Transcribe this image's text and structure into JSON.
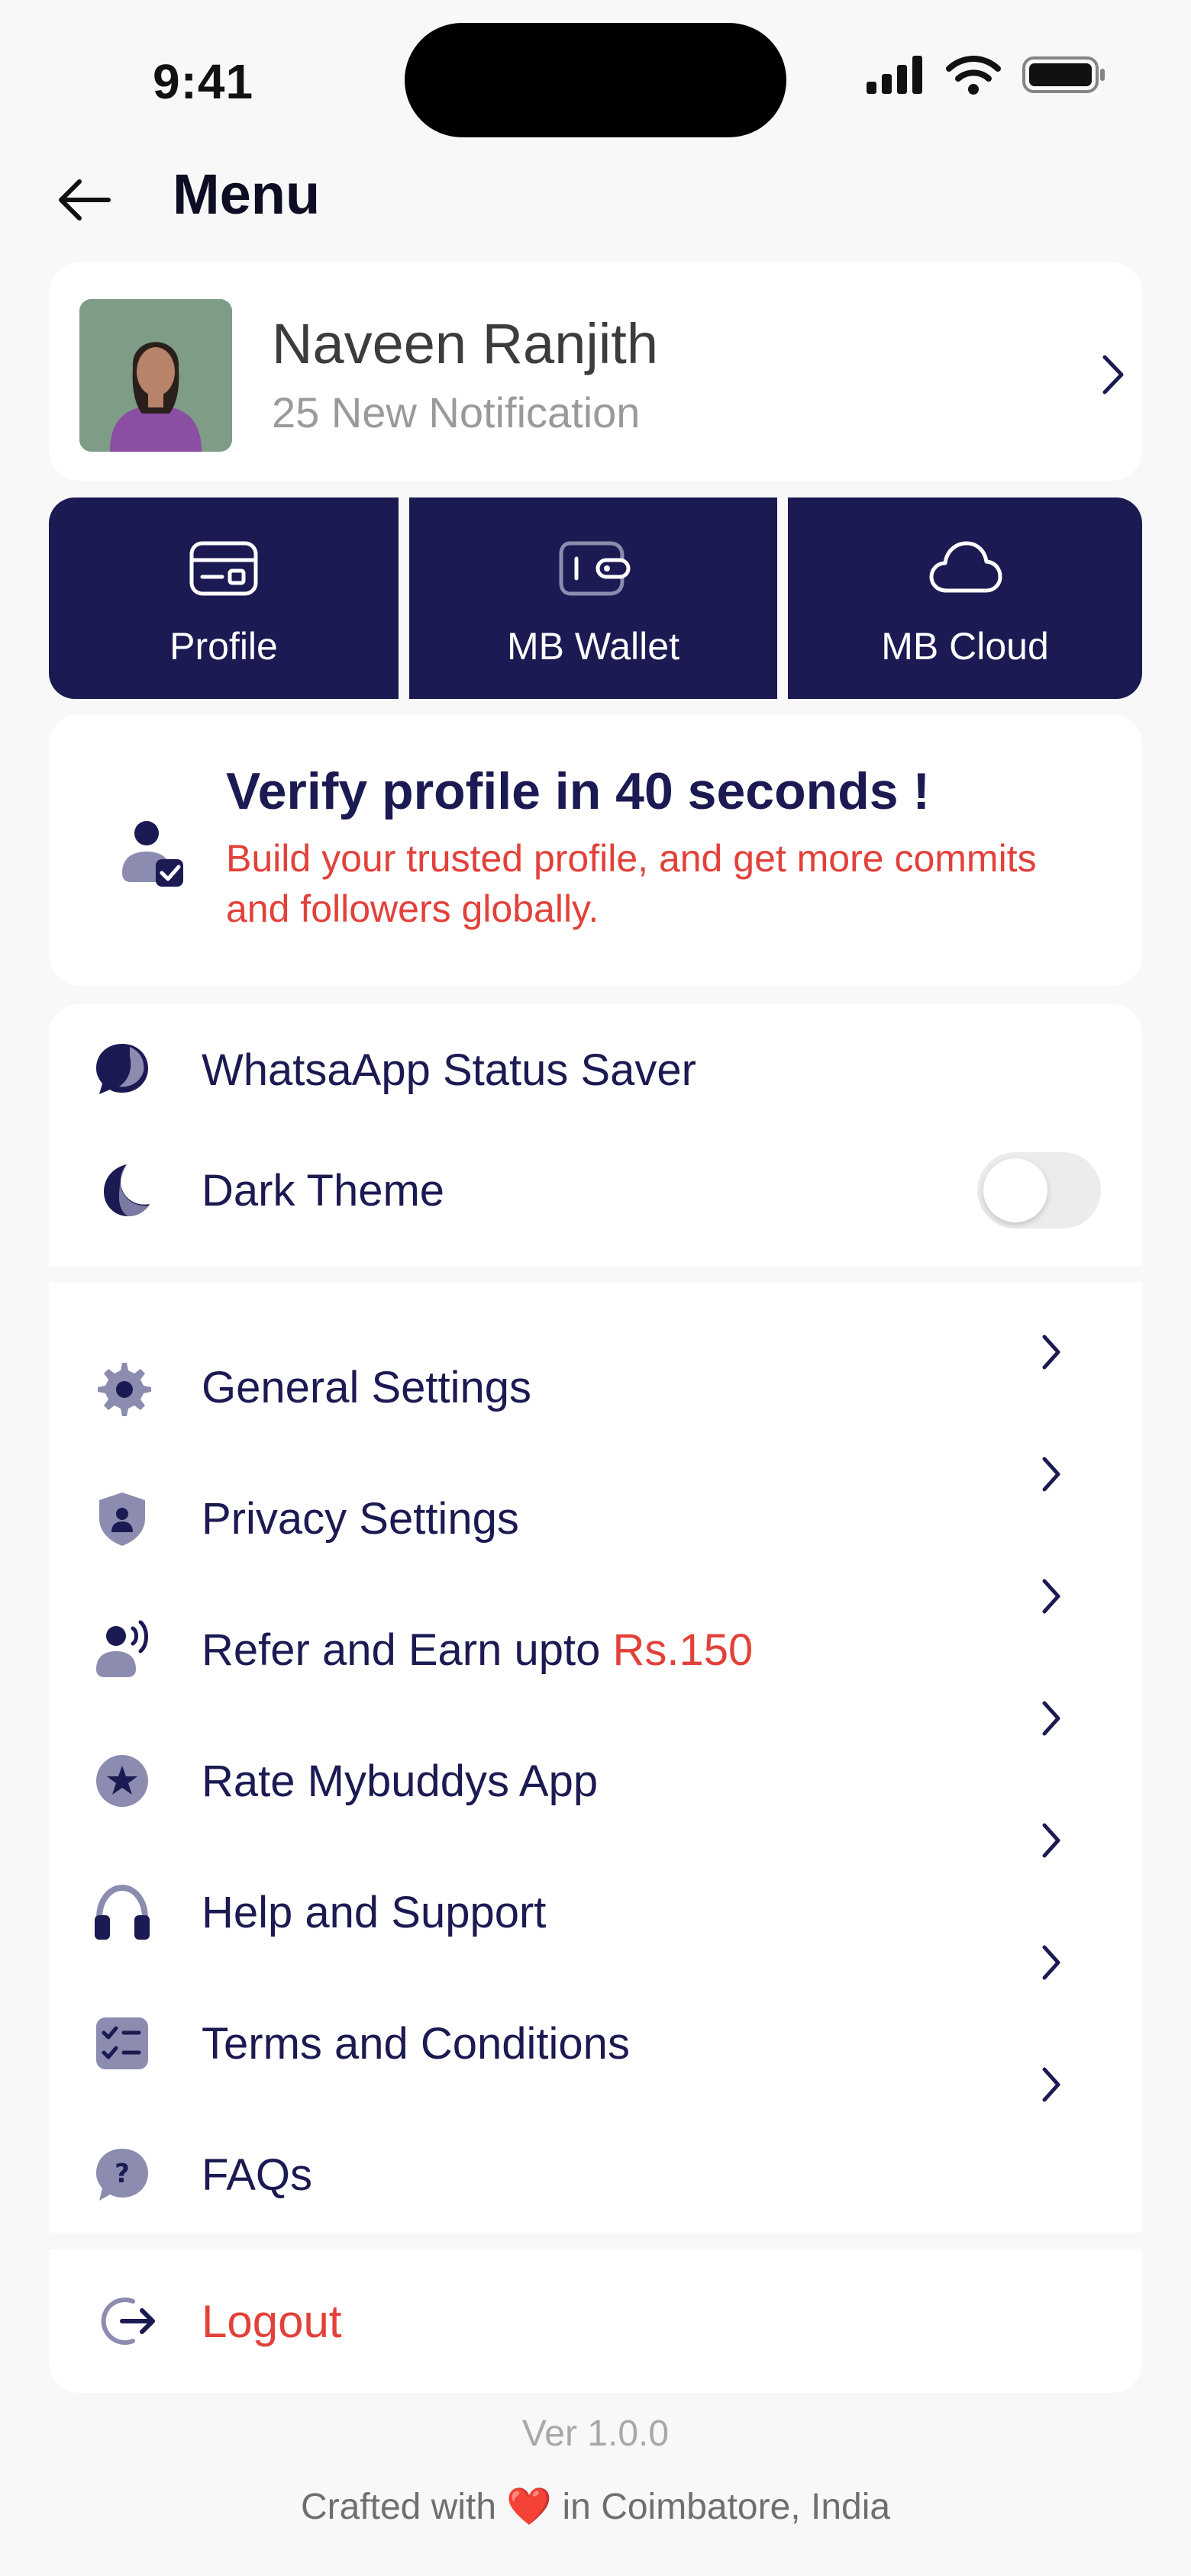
{
  "status_bar": {
    "time": "9:41",
    "icons": [
      "signal-icon",
      "wifi-icon",
      "battery-icon"
    ]
  },
  "header": {
    "title": "Menu",
    "back_icon": "arrow-left-icon"
  },
  "profile": {
    "name": "Naveen Ranjith",
    "notification": "25 New Notification"
  },
  "quick_actions": [
    {
      "label": "Profile",
      "icon": "id-card-icon"
    },
    {
      "label": "MB Wallet",
      "icon": "wallet-icon"
    },
    {
      "label": "MB Cloud",
      "icon": "cloud-icon"
    }
  ],
  "verify": {
    "title": "Verify profile in 40 seconds !",
    "subtitle": "Build your trusted profile, and get more commits and followers globally."
  },
  "group1": {
    "status_saver": "WhatsaApp Status Saver",
    "dark_theme": "Dark Theme",
    "dark_theme_on": false
  },
  "settings": {
    "general": "General Settings",
    "privacy": "Privacy Settings",
    "refer_prefix": "Refer and Earn upto ",
    "refer_amount": "Rs.150",
    "rate": "Rate Mybuddys App",
    "help": "Help and Support",
    "terms": "Terms and Conditions",
    "faqs": "FAQs"
  },
  "logout": {
    "label": "Logout"
  },
  "footer": {
    "version": "Ver 1.0.0",
    "crafted_prefix": "Crafted with",
    "heart": "❤️",
    "crafted_suffix": "in Coimbatore, India"
  },
  "colors": {
    "navy": "#1b1a52",
    "accent_red": "#e2413a",
    "icon_gray": "#7b7ca0",
    "background": "#f8f8f8"
  }
}
